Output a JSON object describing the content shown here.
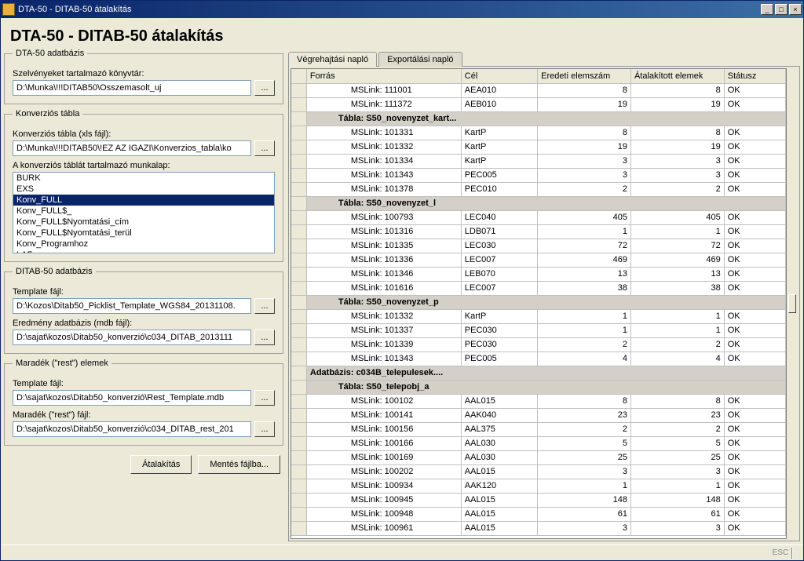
{
  "window": {
    "title": "DTA-50 - DITAB-50 átalakítás"
  },
  "page_title": "DTA-50 - DITAB-50 átalakítás",
  "groups": {
    "db": {
      "legend": "DTA-50 adatbázis",
      "dir_label": "Szelvényeket tartalmazó könyvtár:",
      "dir_value": "D:\\Munka\\!!!DITAB50\\Osszemasolt_uj"
    },
    "conv": {
      "legend": "Konverziós tábla",
      "xls_label": "Konverziós tábla (xls fájl):",
      "xls_value": "D:\\Munka\\!!!DITAB50\\!EZ AZ IGAZI\\Konverzios_tabla\\ko",
      "sheet_label": "A konverziós táblát tartalmazó munkalap:",
      "sheets": [
        "BURK",
        "EXS",
        "Konv_FULL",
        "Konv_FULL$_",
        "Konv_FULL$Nyomtatási_cím",
        "Konv_FULL$Nyomtatási_terül",
        "Konv_Programhoz",
        "LAF"
      ],
      "selected_sheet_index": 2
    },
    "ditab": {
      "legend": "DITAB-50 adatbázis",
      "template_label": "Template fájl:",
      "template_value": "D:\\Kozos\\Ditab50_Picklist_Template_WGS84_20131108.",
      "result_label": "Eredmény adatbázis (mdb fájl):",
      "result_value": "D:\\sajat\\kozos\\Ditab50_konverzió\\c034_DITAB_2013111"
    },
    "rest": {
      "legend": "Maradék (\"rest\") elemek",
      "template_label": "Template fájl:",
      "template_value": "D:\\sajat\\kozos\\Ditab50_konverzió\\Rest_Template.mdb",
      "rest_label": "Maradék (\"rest\") fájl:",
      "rest_value": "D:\\sajat\\kozos\\Ditab50_konverzió\\c034_DITAB_rest_201"
    }
  },
  "buttons": {
    "convert": "Átalakítás",
    "save": "Mentés fájlba..."
  },
  "tabs": {
    "exec": "Végrehajtási napló",
    "export": "Exportálási napló"
  },
  "grid": {
    "columns": [
      "Forrás",
      "Cél",
      "Eredeti elemszám",
      "Átalakított elemek",
      "Státusz"
    ],
    "rows": [
      {
        "type": "data",
        "c": [
          "MSLink: 111001",
          "AEA010",
          "8",
          "8",
          "OK"
        ]
      },
      {
        "type": "data",
        "c": [
          "MSLink: 111372",
          "AEB010",
          "19",
          "19",
          "OK"
        ]
      },
      {
        "type": "group",
        "level": 1,
        "label": "Tábla: S50_novenyzet_kart..."
      },
      {
        "type": "data",
        "c": [
          "MSLink: 101331",
          "KartP",
          "8",
          "8",
          "OK"
        ]
      },
      {
        "type": "data",
        "c": [
          "MSLink: 101332",
          "KartP",
          "19",
          "19",
          "OK"
        ]
      },
      {
        "type": "data",
        "c": [
          "MSLink: 101334",
          "KartP",
          "3",
          "3",
          "OK"
        ]
      },
      {
        "type": "data",
        "c": [
          "MSLink: 101343",
          "PEC005",
          "3",
          "3",
          "OK"
        ]
      },
      {
        "type": "data",
        "c": [
          "MSLink: 101378",
          "PEC010",
          "2",
          "2",
          "OK"
        ]
      },
      {
        "type": "group",
        "level": 1,
        "label": "Tábla: S50_novenyzet_l"
      },
      {
        "type": "data",
        "c": [
          "MSLink: 100793",
          "LEC040",
          "405",
          "405",
          "OK"
        ]
      },
      {
        "type": "data",
        "c": [
          "MSLink: 101316",
          "LDB071",
          "1",
          "1",
          "OK"
        ]
      },
      {
        "type": "data",
        "c": [
          "MSLink: 101335",
          "LEC030",
          "72",
          "72",
          "OK"
        ]
      },
      {
        "type": "data",
        "c": [
          "MSLink: 101336",
          "LEC007",
          "469",
          "469",
          "OK"
        ]
      },
      {
        "type": "data",
        "c": [
          "MSLink: 101346",
          "LEB070",
          "13",
          "13",
          "OK"
        ]
      },
      {
        "type": "data",
        "c": [
          "MSLink: 101616",
          "LEC007",
          "38",
          "38",
          "OK"
        ]
      },
      {
        "type": "group",
        "level": 1,
        "label": "Tábla: S50_novenyzet_p"
      },
      {
        "type": "data",
        "c": [
          "MSLink: 101332",
          "KartP",
          "1",
          "1",
          "OK"
        ]
      },
      {
        "type": "data",
        "c": [
          "MSLink: 101337",
          "PEC030",
          "1",
          "1",
          "OK"
        ]
      },
      {
        "type": "data",
        "c": [
          "MSLink: 101339",
          "PEC030",
          "2",
          "2",
          "OK"
        ]
      },
      {
        "type": "data",
        "c": [
          "MSLink: 101343",
          "PEC005",
          "4",
          "4",
          "OK"
        ]
      },
      {
        "type": "group",
        "level": 0,
        "label": "Adatbázis: c034B_telepulesek...."
      },
      {
        "type": "group",
        "level": 1,
        "label": "Tábla: S50_telepobj_a"
      },
      {
        "type": "data",
        "c": [
          "MSLink: 100102",
          "AAL015",
          "8",
          "8",
          "OK"
        ]
      },
      {
        "type": "data",
        "c": [
          "MSLink: 100141",
          "AAK040",
          "23",
          "23",
          "OK"
        ]
      },
      {
        "type": "data",
        "c": [
          "MSLink: 100156",
          "AAL375",
          "2",
          "2",
          "OK"
        ]
      },
      {
        "type": "data",
        "c": [
          "MSLink: 100166",
          "AAL030",
          "5",
          "5",
          "OK"
        ]
      },
      {
        "type": "data",
        "c": [
          "MSLink: 100169",
          "AAL030",
          "25",
          "25",
          "OK"
        ]
      },
      {
        "type": "data",
        "c": [
          "MSLink: 100202",
          "AAL015",
          "3",
          "3",
          "OK"
        ]
      },
      {
        "type": "data",
        "c": [
          "MSLink: 100934",
          "AAK120",
          "1",
          "1",
          "OK"
        ]
      },
      {
        "type": "data",
        "c": [
          "MSLink: 100945",
          "AAL015",
          "148",
          "148",
          "OK"
        ]
      },
      {
        "type": "data",
        "c": [
          "MSLink: 100948",
          "AAL015",
          "61",
          "61",
          "OK"
        ]
      },
      {
        "type": "data",
        "c": [
          "MSLink: 100961",
          "AAL015",
          "3",
          "3",
          "OK"
        ]
      }
    ]
  },
  "status": {
    "esc": "ESC"
  }
}
